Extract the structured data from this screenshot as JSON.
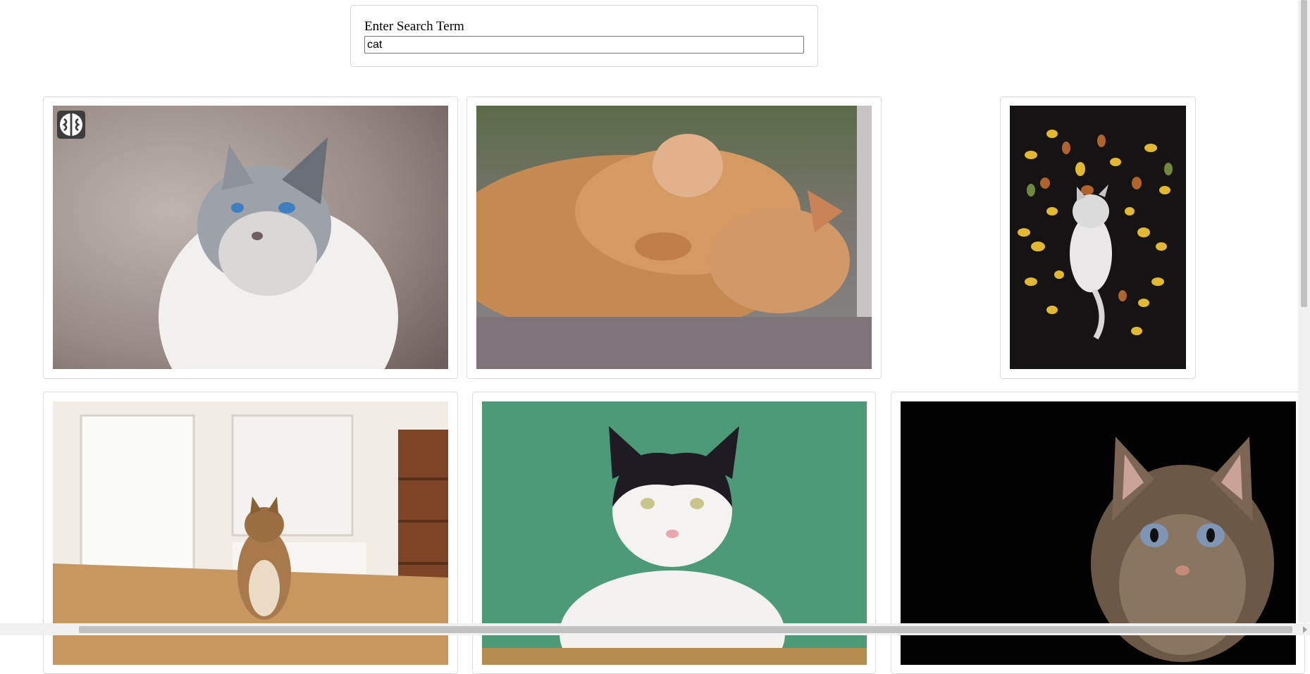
{
  "search": {
    "label": "Enter Search Term",
    "value": "cat"
  },
  "results": [
    {
      "subject": "siamese cat looking up"
    },
    {
      "subject": "orange tabby cat sleeping"
    },
    {
      "subject": "cat lying among autumn leaves"
    },
    {
      "subject": "tabby cat sitting on kitchen table"
    },
    {
      "subject": "black and white cat on green background"
    },
    {
      "subject": "tabby cat with blue eyes on black background"
    }
  ],
  "badge_icon": "brain-icon"
}
